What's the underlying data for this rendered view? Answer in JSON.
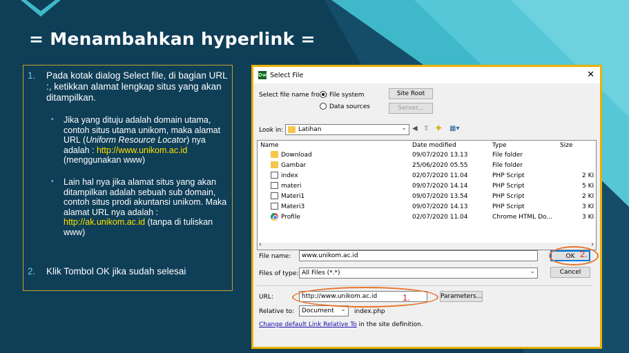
{
  "slide": {
    "title": "= Menambahkan hyperlink =",
    "steps": [
      {
        "num": "1.",
        "text": "Pada kotak dialog Select file, di bagian URL :, ketikkan alamat lengkap situs yang akan ditampilkan."
      },
      {
        "num": "2.",
        "text": "Klik Tombol OK jika sudah selesai"
      }
    ],
    "bullets": [
      {
        "bullet": "•",
        "pre": "Jika yang dituju adalah domain utama, contoh situs utama unikom, maka alamat URL (",
        "italic": "Uniform Resource Locator",
        "mid": ") nya adalah : ",
        "link": "http://www.unikom.ac.id",
        "post": " (menggunakan www)"
      },
      {
        "bullet": "•",
        "pre": "Lain hal nya jika alamat situs yang akan ditampilkan adalah sebuah sub domain, contoh situs prodi akuntansi unikom. Maka alamat URL nya adalah : ",
        "link": "http://ak.unikom.ac.id",
        "post": " (tanpa di tuliskan www)"
      }
    ],
    "colors": {
      "background": "#0f3e57",
      "accent_teal": "#3fb9c9",
      "border_gold": "#c9a227",
      "link": "#ffe100"
    }
  },
  "dialog": {
    "app_icon": "Dw",
    "title": "Select File",
    "close_icon": "close-icon",
    "select_from_label": "Select file name from:",
    "radio_file_system": "File system",
    "radio_data_sources": "Data sources",
    "site_root_button": "Site Root",
    "server_button": "Server...",
    "look_in_label": "Look in:",
    "look_in_value": "Latihan",
    "columns": [
      "Name",
      "Date modified",
      "Type",
      "Size"
    ],
    "files": [
      {
        "icon": "folder-icon",
        "name": "Download",
        "date": "09/07/2020 13.13",
        "type": "File folder",
        "size": ""
      },
      {
        "icon": "folder-icon",
        "name": "Gambar",
        "date": "25/06/2020 05.55",
        "type": "File folder",
        "size": ""
      },
      {
        "icon": "php-file-icon",
        "name": "index",
        "date": "02/07/2020 11.04",
        "type": "PHP Script",
        "size": "2 KI"
      },
      {
        "icon": "php-file-icon",
        "name": "materi",
        "date": "09/07/2020 14.14",
        "type": "PHP Script",
        "size": "5 KI"
      },
      {
        "icon": "php-file-icon",
        "name": "Materi1",
        "date": "09/07/2020 13.54",
        "type": "PHP Script",
        "size": "2 KI"
      },
      {
        "icon": "php-file-icon",
        "name": "Materi3",
        "date": "09/07/2020 14.13",
        "type": "PHP Script",
        "size": "3 KI"
      },
      {
        "icon": "chrome-icon",
        "name": "Profile",
        "date": "02/07/2020 11.04",
        "type": "Chrome HTML Do...",
        "size": "3 KI"
      }
    ],
    "file_name_label": "File name:",
    "file_name_value": "www.unikom.ac.id",
    "files_of_type_label": "Files of type:",
    "files_of_type_value": "All Files (*.*)",
    "ok_button": "OK",
    "cancel_button": "Cancel",
    "url_label": "URL:",
    "url_value": "http://www.unikom.ac.id",
    "parameters_button": "Parameters...",
    "relative_to_label": "Relative to:",
    "relative_to_value": "Document",
    "relative_file": "index.php",
    "change_link": "Change default Link Relative To",
    "change_link_suffix": " in the site definition.",
    "annotation_1": "1.",
    "annotation_2": "2."
  }
}
